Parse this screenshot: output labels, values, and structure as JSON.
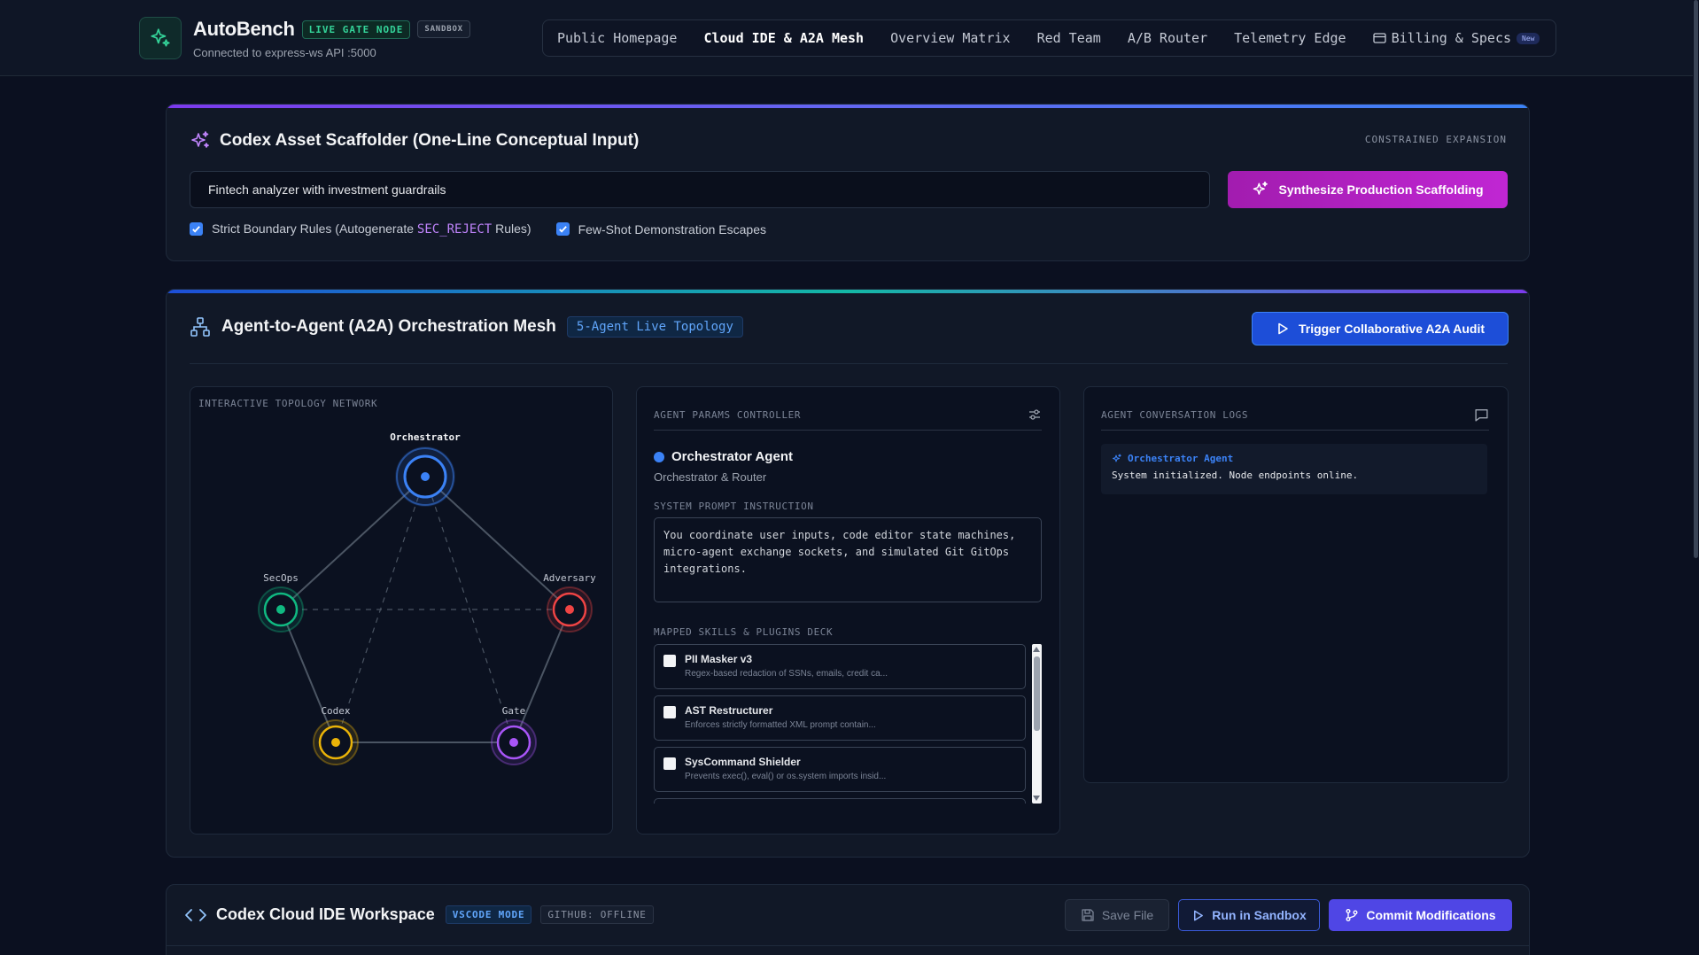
{
  "header": {
    "brand": "AutoBench",
    "live_badge": "LIVE GATE NODE",
    "sandbox_badge": "SANDBOX",
    "connection": "Connected to express-ws API :5000",
    "nav": [
      {
        "label": "Public Homepage"
      },
      {
        "label": "Cloud IDE & A2A Mesh"
      },
      {
        "label": "Overview Matrix"
      },
      {
        "label": "Red Team"
      },
      {
        "label": "A/B Router"
      },
      {
        "label": "Telemetry Edge"
      },
      {
        "label": "Billing & Specs",
        "pill": "New"
      }
    ]
  },
  "scaffolder": {
    "title": "Codex Asset Scaffolder (One-Line Conceptual Input)",
    "tag": "CONSTRAINED EXPANSION",
    "input_value": "Fintech analyzer with investment guardrails",
    "button": "Synthesize Production Scaffolding",
    "check1_prefix": "Strict Boundary Rules (Autogenerate ",
    "check1_code": "SEC_REJECT",
    "check1_suffix": " Rules)",
    "check2": "Few-Shot Demonstration Escapes"
  },
  "mesh": {
    "title": "Agent-to-Agent (A2A) Orchestration Mesh",
    "badge": "5-Agent Live Topology",
    "trigger": "Trigger Collaborative A2A Audit",
    "topology_label": "INTERACTIVE TOPOLOGY NETWORK",
    "nodes": [
      {
        "label": "Orchestrator",
        "color": "#3b82f6"
      },
      {
        "label": "SecOps",
        "color": "#10b981"
      },
      {
        "label": "Adversary",
        "color": "#ef4444"
      },
      {
        "label": "Codex",
        "color": "#eab308"
      },
      {
        "label": "Gate",
        "color": "#a855f7"
      }
    ],
    "params": {
      "label": "AGENT PARAMS CONTROLLER",
      "agent_name": "Orchestrator Agent",
      "agent_role": "Orchestrator & Router",
      "sp_label": "SYSTEM PROMPT INSTRUCTION",
      "system_prompt": "You coordinate user inputs, code editor state machines, micro-agent exchange sockets, and simulated Git GitOps integrations.",
      "skills_label": "MAPPED SKILLS & PLUGINS DECK",
      "skills": [
        {
          "name": "PII Masker v3",
          "desc": "Regex-based redaction of SSNs, emails, credit ca..."
        },
        {
          "name": "AST Restructurer",
          "desc": "Enforces strictly formatted XML prompt contain..."
        },
        {
          "name": "SysCommand Shielder",
          "desc": "Prevents exec(), eval() or os.system imports insid..."
        }
      ]
    },
    "logs": {
      "label": "AGENT CONVERSATION LOGS",
      "entries": [
        {
          "from": "Orchestrator Agent",
          "text": "System initialized. Node endpoints online."
        }
      ]
    }
  },
  "ide": {
    "title": "Codex Cloud IDE Workspace",
    "mode_badge": "VSCODE MODE",
    "github_badge": "GITHUB: OFFLINE",
    "save": "Save File",
    "run": "Run in Sandbox",
    "commit": "Commit Modifications"
  }
}
